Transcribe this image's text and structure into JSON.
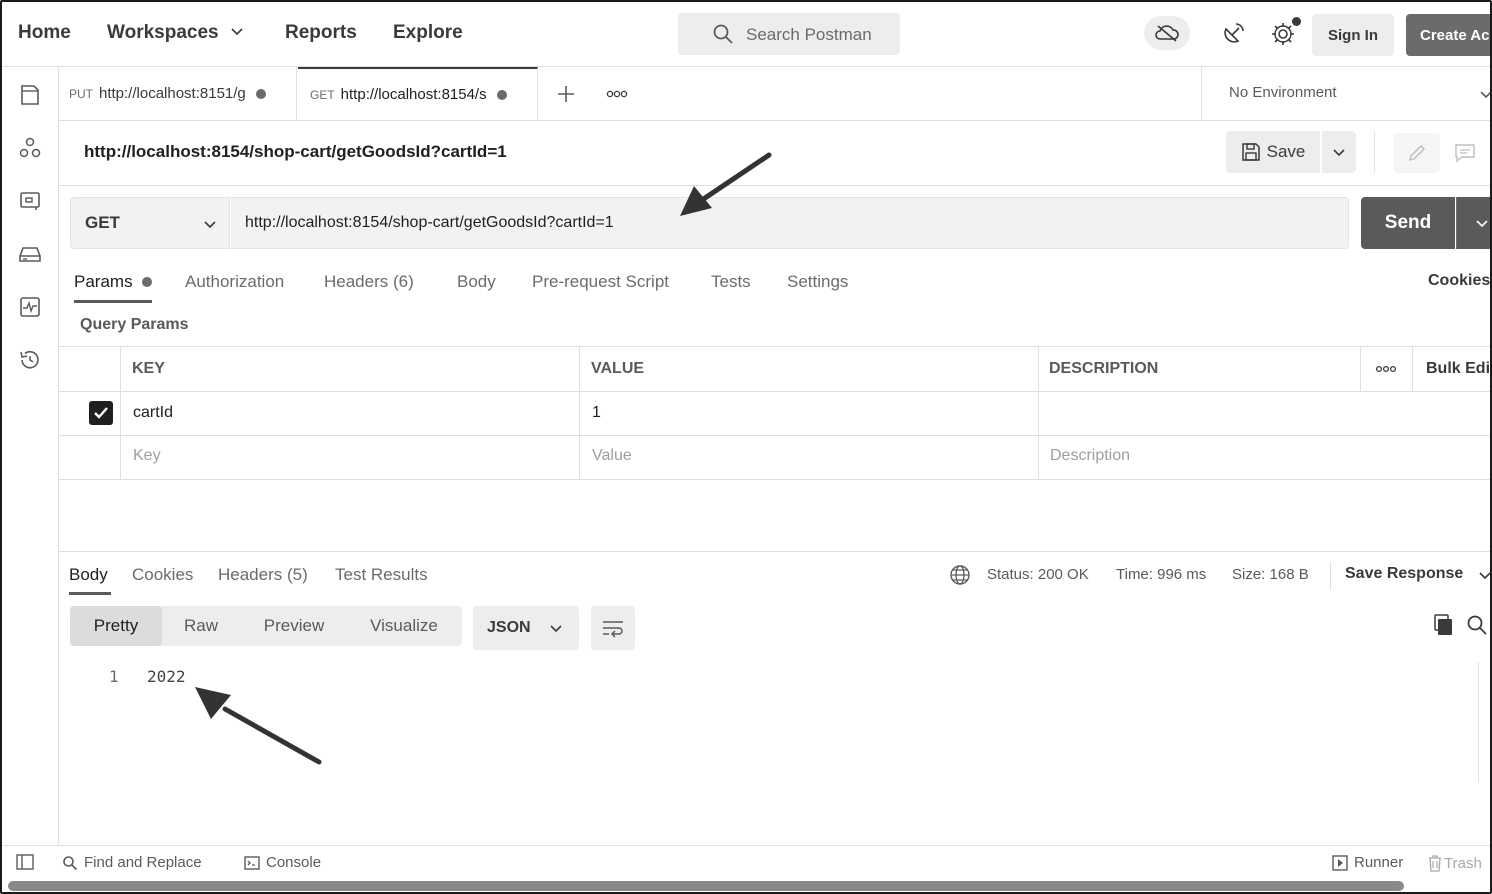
{
  "topbar": {
    "nav": [
      "Home",
      "Workspaces",
      "Reports",
      "Explore"
    ],
    "search_placeholder": "Search Postman",
    "sign_in": "Sign In",
    "create_account": "Create Ac"
  },
  "tabs": [
    {
      "method": "PUT",
      "title": "http://localhost:8151/g"
    },
    {
      "method": "GET",
      "title": "http://localhost:8154/s"
    }
  ],
  "environment": "No Environment",
  "request": {
    "title": "http://localhost:8154/shop-cart/getGoodsId?cartId=1",
    "save": "Save",
    "method": "GET",
    "url": "http://localhost:8154/shop-cart/getGoodsId?cartId=1",
    "send": "Send"
  },
  "request_tabs": [
    "Params",
    "Authorization",
    "Headers (6)",
    "Body",
    "Pre-request Script",
    "Tests",
    "Settings"
  ],
  "cookies_link": "Cookies",
  "query_params": {
    "label": "Query Params",
    "headers": {
      "key": "KEY",
      "value": "VALUE",
      "description": "DESCRIPTION",
      "bulk_edit": "Bulk Edi"
    },
    "rows": [
      {
        "key": "cartId",
        "value": "1",
        "description": "",
        "checked": true
      }
    ],
    "placeholders": {
      "key": "Key",
      "value": "Value",
      "description": "Description"
    }
  },
  "response": {
    "tabs": [
      "Body",
      "Cookies",
      "Headers (5)",
      "Test Results"
    ],
    "status": "Status: 200 OK",
    "time": "Time: 996 ms",
    "size": "Size: 168 B",
    "save_response": "Save Response",
    "views": [
      "Pretty",
      "Raw",
      "Preview",
      "Visualize"
    ],
    "format": "JSON",
    "lines": [
      {
        "num": "1",
        "text": "2022"
      }
    ]
  },
  "statusbar": {
    "find_replace": "Find and Replace",
    "console": "Console",
    "runner": "Runner",
    "trash": "Trash"
  }
}
